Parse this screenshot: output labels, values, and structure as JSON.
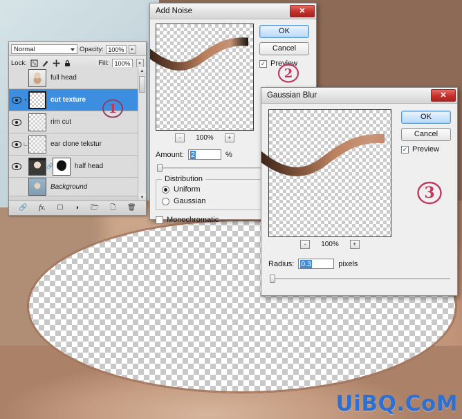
{
  "app": {
    "watermark": "UiBQ.CoM"
  },
  "layers_panel": {
    "name": "Layers panel",
    "blend_mode": "Normal",
    "opacity_label": "Opacity:",
    "opacity_value": "100%",
    "lock_label": "Lock:",
    "fill_label": "Fill:",
    "fill_value": "100%",
    "lock_icons": [
      "lock-transparent-pixels-icon",
      "lock-image-pixels-icon",
      "lock-position-icon",
      "lock-all-icon"
    ],
    "layers": [
      {
        "name": "full head",
        "visible": false,
        "selected": false,
        "thumb": "face",
        "has_mask": false,
        "linked": false,
        "italic": false
      },
      {
        "name": "cut texture",
        "visible": true,
        "selected": true,
        "thumb": "transparent",
        "has_mask": false,
        "linked": true,
        "italic": false
      },
      {
        "name": "rim cut",
        "visible": true,
        "selected": false,
        "thumb": "transparent",
        "has_mask": false,
        "linked": false,
        "italic": false
      },
      {
        "name": "ear clone tekstur",
        "visible": true,
        "selected": false,
        "thumb": "transparent",
        "has_mask": false,
        "linked": true,
        "italic": false
      },
      {
        "name": "half head",
        "visible": true,
        "selected": false,
        "thumb": "face2",
        "has_mask": true,
        "linked": true,
        "italic": false
      },
      {
        "name": "Background",
        "visible": false,
        "selected": false,
        "thumb": "bg",
        "has_mask": false,
        "linked": false,
        "italic": true
      }
    ],
    "footer_icons": [
      "link-layers-icon",
      "layer-style-fx-icon",
      "add-layer-mask-icon",
      "new-fill-adjustment-icon",
      "new-group-icon",
      "new-layer-icon",
      "delete-layer-icon"
    ],
    "scroll_up": "▲",
    "scroll_down": "▼"
  },
  "add_noise_dialog": {
    "title": "Add Noise",
    "close_label": "✕",
    "ok_label": "OK",
    "cancel_label": "Cancel",
    "preview_label": "Preview",
    "preview_checked": true,
    "zoom_out": "-",
    "zoom_in": "+",
    "zoom_level": "100%",
    "amount_label": "Amount:",
    "amount_value": "2",
    "amount_unit": "%",
    "distribution_label": "Distribution",
    "distribution_options": [
      "Uniform",
      "Gaussian"
    ],
    "distribution_selected": "Uniform",
    "monochromatic_label": "Monochromatic",
    "monochromatic_checked": false
  },
  "gaussian_blur_dialog": {
    "title": "Gaussian Blur",
    "close_label": "✕",
    "ok_label": "OK",
    "cancel_label": "Cancel",
    "preview_label": "Preview",
    "preview_checked": true,
    "zoom_out": "-",
    "zoom_in": "+",
    "zoom_level": "100%",
    "radius_label": "Radius:",
    "radius_value": "0.3",
    "radius_unit": "pixels"
  },
  "annotations": {
    "marker_1": "1",
    "marker_2": "2",
    "marker_3": "3",
    "color": "#c0395f"
  }
}
